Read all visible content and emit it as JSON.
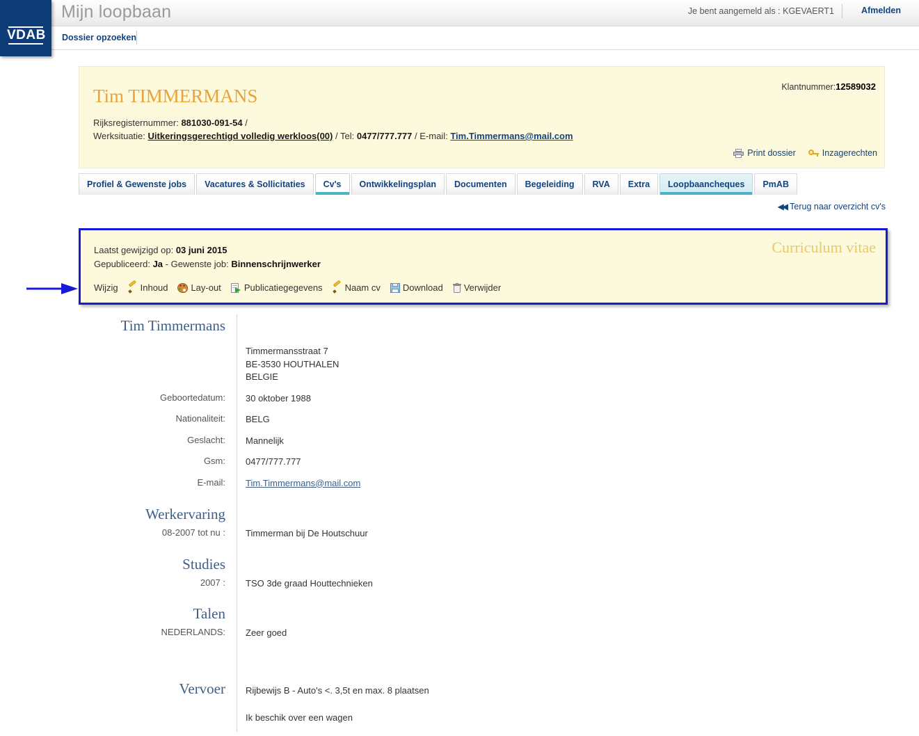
{
  "header": {
    "app_title": "Mijn loopbaan",
    "login_info": "Je bent aangemeld als : KGEVAERT1",
    "logout_label": "Afmelden",
    "nav_link": "Dossier opzoeken",
    "logo_text": "VDAB"
  },
  "client": {
    "name": "Tim TIMMERMANS",
    "rijksregister_label": "Rijksregisternummer:",
    "rijksregister_value": "881030-091-54",
    "werksituatie_label": "Werksituatie:",
    "werksituatie_value": "Uitkeringsgerechtigd volledig werkloos(00)",
    "tel_label": "Tel:",
    "tel_value": "0477/777.777",
    "email_label": "E-mail:",
    "email_value": "Tim.Timmermans@mail.com",
    "klantnummer_label": "Klantnummer:",
    "klantnummer_value": "12589032",
    "print_label": "Print dossier",
    "inzage_label": "Inzagerechten"
  },
  "tabs": [
    {
      "label": "Profiel & Gewenste jobs",
      "state": "normal"
    },
    {
      "label": "Vacatures & Sollicitaties",
      "state": "normal"
    },
    {
      "label": "Cv's",
      "state": "active"
    },
    {
      "label": "Ontwikkelingsplan",
      "state": "normal"
    },
    {
      "label": "Documenten",
      "state": "normal"
    },
    {
      "label": "Begeleiding",
      "state": "normal"
    },
    {
      "label": "RVA",
      "state": "normal"
    },
    {
      "label": "Extra",
      "state": "normal"
    },
    {
      "label": "Loopbaancheques",
      "state": "highlight"
    },
    {
      "label": "PmAB",
      "state": "normal"
    }
  ],
  "back_link": "Terug naar overzicht cv's",
  "cvbox": {
    "title": "Curriculum vitae",
    "modified_label": "Laatst gewijzigd op:",
    "modified_value": "03 juni 2015",
    "published_label": "Gepubliceerd:",
    "published_value": "Ja",
    "job_label": "- Gewenste job:",
    "job_value": "Binnenschrijnwerker",
    "wijzig_label": "Wijzig",
    "actions": [
      {
        "label": "Inhoud",
        "icon": "pencil-icon"
      },
      {
        "label": "Lay-out",
        "icon": "palette-icon"
      },
      {
        "label": "Publicatiegegevens",
        "icon": "publish-icon"
      },
      {
        "label": "Naam cv",
        "icon": "pencil-icon"
      },
      {
        "label": "Download",
        "icon": "floppy-icon"
      },
      {
        "label": "Verwijder",
        "icon": "trash-icon"
      }
    ]
  },
  "cv": {
    "person_name": "Tim Timmermans",
    "address": "Timmermansstraat 7\nBE-3530 HOUTHALEN\nBELGIE",
    "geboortedatum_label": "Geboortedatum:",
    "geboortedatum_value": "30 oktober 1988",
    "nationaliteit_label": "Nationaliteit:",
    "nationaliteit_value": "BELG",
    "geslacht_label": "Geslacht:",
    "geslacht_value": "Mannelijk",
    "gsm_label": "Gsm:",
    "gsm_value": "0477/777.777",
    "email_label": "E-mail:",
    "email_value": "Tim.Timmermans@mail.com",
    "werkervaring_heading": "Werkervaring",
    "werkervaring_period": "08-2007 tot nu :",
    "werkervaring_value": "Timmerman bij De Houtschuur",
    "studies_heading": "Studies",
    "studies_period": "2007 :",
    "studies_value": "TSO 3de graad Houttechnieken",
    "talen_heading": "Talen",
    "talen_label": "NEDERLANDS:",
    "talen_value": "Zeer goed",
    "vervoer_heading": "Vervoer",
    "vervoer_value1": "Rijbewijs B - Auto's <. 3,5t en max. 8 plaatsen",
    "vervoer_value2": "Ik beschik over een wagen"
  },
  "colors": {
    "brand_blue": "#0d3c79",
    "panel_yellow": "#fdf9dc",
    "accent_teal": "#4bb3c4",
    "link_blue": "#13437e",
    "gold": "#e8a33d",
    "annotation_blue": "#1718d8"
  }
}
